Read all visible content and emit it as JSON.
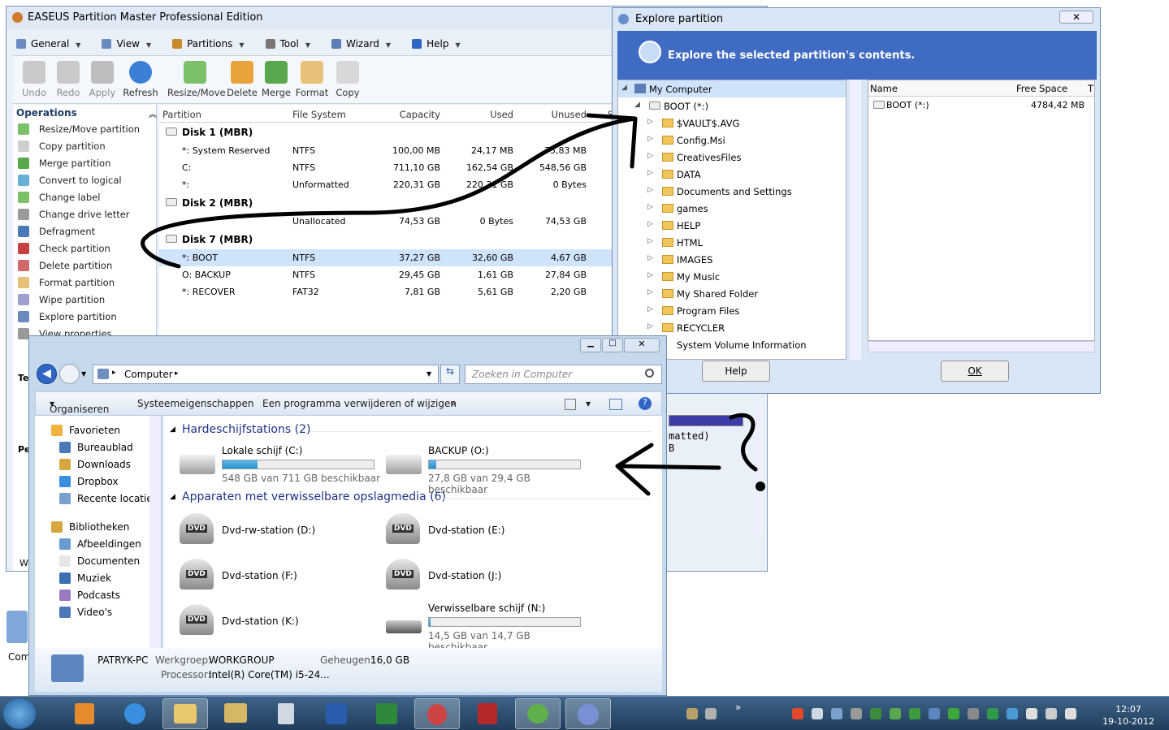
{
  "easeus": {
    "title": "EASEUS Partition Master Professional Edition",
    "menu": [
      "General",
      "View",
      "Partitions",
      "Tool",
      "Wizard",
      "Help"
    ],
    "toolbar": {
      "undo": "Undo",
      "redo": "Redo",
      "apply": "Apply",
      "refresh": "Refresh",
      "resize": "Resize/Move",
      "delete": "Delete",
      "merge": "Merge",
      "format": "Format",
      "copy": "Copy"
    },
    "operations_title": "Operations",
    "operations": [
      "Resize/Move partition",
      "Copy partition",
      "Merge partition",
      "Convert to logical",
      "Change label",
      "Change drive letter",
      "Defragment",
      "Check partition",
      "Delete partition",
      "Format partition",
      "Wipe partition",
      "Explore partition",
      "View properties"
    ],
    "columns": {
      "partition": "Partition",
      "fs": "File System",
      "capacity": "Capacity",
      "used": "Used",
      "unused": "Unused",
      "s": "S"
    },
    "disks": [
      {
        "name": "Disk 1 (MBR)",
        "rows": [
          {
            "partition": "*: System Reserved",
            "fs": "NTFS",
            "capacity": "100,00 MB",
            "used": "24,17 MB",
            "unused": "75,83 MB"
          },
          {
            "partition": "C:",
            "fs": "NTFS",
            "capacity": "711,10 GB",
            "used": "162,54 GB",
            "unused": "548,56 GB"
          },
          {
            "partition": "*:",
            "fs": "Unformatted",
            "capacity": "220,31 GB",
            "used": "220,31 GB",
            "unused": "0 Bytes"
          }
        ]
      },
      {
        "name": "Disk 2 (MBR)",
        "rows": [
          {
            "partition": "",
            "fs": "Unallocated",
            "capacity": "74,53 GB",
            "used": "0 Bytes",
            "unused": "74,53 GB"
          }
        ]
      },
      {
        "name": "Disk 7 (MBR)",
        "rows": [
          {
            "partition": "*: BOOT",
            "fs": "NTFS",
            "capacity": "37,27 GB",
            "used": "32,60 GB",
            "unused": "4,67 GB"
          },
          {
            "partition": "O: BACKUP",
            "fs": "NTFS",
            "capacity": "29,45 GB",
            "used": "1,61 GB",
            "unused": "27,84 GB"
          },
          {
            "partition": "*: RECOVER",
            "fs": "FAT32",
            "capacity": "7,81 GB",
            "used": "5,61 GB",
            "unused": "2,20 GB"
          }
        ]
      }
    ],
    "sidebar_left_1": "Te",
    "sidebar_left_2": "Pe",
    "status_left": "We",
    "bg_text_1": "matted)",
    "bg_text_2": "B"
  },
  "explore": {
    "title": "Explore partition",
    "banner": "Explore the selected partition's contents.",
    "tree_root": "My Computer",
    "tree_drive": "BOOT (*:)",
    "folders": [
      "$VAULT$.AVG",
      "Config.Msi",
      "CreativesFiles",
      "DATA",
      "Documents and Settings",
      "games",
      "HELP",
      "HTML",
      "IMAGES",
      "My Music",
      "My Shared Folder",
      "Program Files",
      "RECYCLER",
      "System Volume Information"
    ],
    "list_cols": {
      "name": "Name",
      "free": "Free Space",
      "t": "T"
    },
    "list_row": {
      "name": "BOOT (*:)",
      "free": "4784,42 MB"
    },
    "help_btn": "Help",
    "ok_btn": "OK"
  },
  "explorer": {
    "address": "Computer",
    "search_placeholder": "Zoeken in Computer",
    "cmd": {
      "organize": "Organiseren",
      "sysprops": "Systeemeigenschappen",
      "uninstall": "Een programma verwijderen of wijzigen",
      "more": "»"
    },
    "nav": {
      "favorites": "Favorieten",
      "fav_items": [
        "Bureaublad",
        "Downloads",
        "Dropbox",
        "Recente locaties"
      ],
      "libraries": "Bibliotheken",
      "lib_items": [
        "Afbeeldingen",
        "Documenten",
        "Muziek",
        "Podcasts",
        "Video's"
      ]
    },
    "sec_hdd": "Hardeschijfstations (2)",
    "drives": [
      {
        "name": "Lokale schijf (C:)",
        "info": "548 GB van 711 GB beschikbaar",
        "fill": 0.23
      },
      {
        "name": "BACKUP (O:)",
        "info": "27,8 GB van 29,4 GB beschikbaar",
        "fill": 0.05
      }
    ],
    "sec_removable": "Apparaten met verwisselbare opslagmedia (6)",
    "devices": [
      "Dvd-rw-station (D:)",
      "Dvd-station (E:)",
      "Dvd-station (F:)",
      "Dvd-station (J:)",
      "Dvd-station (K:)"
    ],
    "removable": {
      "name": "Verwisselbare schijf (N:)",
      "info": "14,5 GB van 14,7 GB beschikbaar",
      "fill": 0.01
    },
    "dvd_label": "DVD",
    "details": {
      "pc": "PATRYK-PC",
      "wg_label": "Werkgroep:",
      "wg": "WORKGROUP",
      "mem_label": "Geheugen:",
      "mem": "16,0 GB",
      "proc_label": "Processor:",
      "proc": "Intel(R) Core(TM) i5-24..."
    }
  },
  "desktop": {
    "icon_label": "Com"
  },
  "taskbar": {
    "time": "12:07",
    "date": "19-10-2012"
  },
  "colors": {
    "accent": "#3f6bc2",
    "taskbar": "#2b4c6f",
    "selection": "#cfe3fb",
    "progress": "#2a8fd0"
  }
}
